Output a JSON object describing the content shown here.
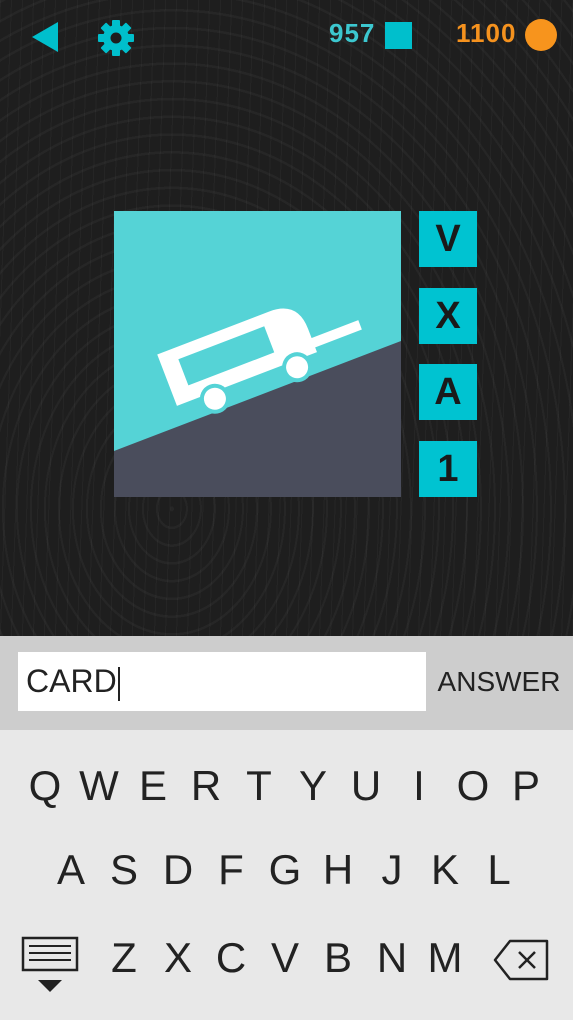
{
  "header": {
    "squares_count": "957",
    "coins_count": "1100",
    "accent_color": "#00bfcc",
    "coin_color": "#f7941d",
    "back_icon": "back-triangle-icon",
    "settings_icon": "gear-icon"
  },
  "puzzle": {
    "image_icon": "trailer-on-slope-icon",
    "options": [
      "V",
      "X",
      "A",
      "1"
    ]
  },
  "answer": {
    "value": "CARD",
    "button_label": "ANSWER"
  },
  "keyboard": {
    "row1": [
      "Q",
      "W",
      "E",
      "R",
      "T",
      "Y",
      "U",
      "I",
      "O",
      "P"
    ],
    "row2": [
      "A",
      "S",
      "D",
      "F",
      "G",
      "H",
      "J",
      "K",
      "L"
    ],
    "row3": [
      "Z",
      "X",
      "C",
      "V",
      "B",
      "N",
      "M"
    ],
    "hide_icon": "keyboard-hide-icon",
    "backspace_icon": "backspace-icon"
  }
}
